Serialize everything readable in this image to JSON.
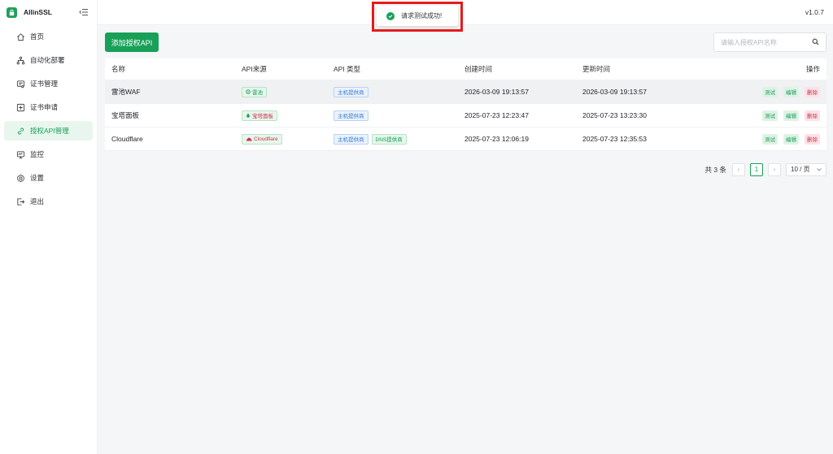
{
  "app": {
    "name": "AllinSSL",
    "version": "v1.0.7"
  },
  "sidebar": {
    "items": [
      {
        "label": "首页",
        "icon": "home-icon",
        "active": false
      },
      {
        "label": "自动化部署",
        "icon": "workflow-icon",
        "active": false
      },
      {
        "label": "证书管理",
        "icon": "certificate-icon",
        "active": false
      },
      {
        "label": "证书申请",
        "icon": "add-certificate-icon",
        "active": false
      },
      {
        "label": "授权API管理",
        "icon": "link-icon",
        "active": true
      },
      {
        "label": "监控",
        "icon": "monitor-icon",
        "active": false
      },
      {
        "label": "设置",
        "icon": "gear-icon",
        "active": false
      },
      {
        "label": "退出",
        "icon": "logout-icon",
        "active": false
      }
    ]
  },
  "toast": {
    "text": "请求测试成功!",
    "icon": "success-check-icon"
  },
  "toolbar": {
    "add_label": "添加授权API",
    "search_placeholder": "请输入授权API名称"
  },
  "table": {
    "columns": {
      "name": "名称",
      "source": "API来源",
      "type": "API 类型",
      "created": "创建时间",
      "updated": "更新时间",
      "ops": "操作"
    },
    "rows": [
      {
        "name": "雷池WAF",
        "source": "雷池",
        "source_icon": "safeline-icon",
        "types": [
          "主机提供商"
        ],
        "created": "2026-03-09 19:13:57",
        "updated": "2026-03-09 19:13:57",
        "highlighted": true
      },
      {
        "name": "宝塔面板",
        "source": "宝塔面板",
        "source_icon": "btpanel-icon",
        "types": [
          "主机提供商"
        ],
        "created": "2025-07-23 12:23:47",
        "updated": "2025-07-23 13:23:30",
        "highlighted": false
      },
      {
        "name": "Cloudflare",
        "source": "Cloudflare",
        "source_icon": "cloudflare-icon",
        "types": [
          "主机提供商",
          "DNS提供商"
        ],
        "created": "2025-07-23 12:06:19",
        "updated": "2025-07-23 12:35:53",
        "highlighted": false
      }
    ],
    "actions": {
      "test": "测试",
      "edit": "编辑",
      "delete": "删除"
    }
  },
  "pagination": {
    "total_text": "共 3 条",
    "current_page": "1",
    "page_size": "10 / 页",
    "prev": "‹",
    "next": "›"
  },
  "colors": {
    "accent": "#18a058",
    "danger": "#d03050",
    "highlight": "#e51b1b"
  }
}
